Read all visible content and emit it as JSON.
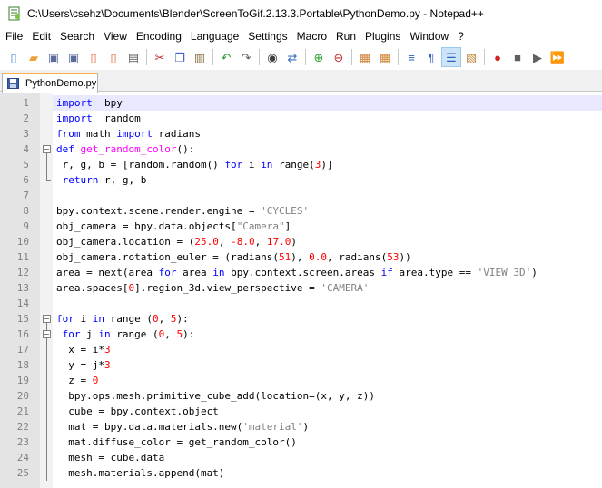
{
  "window": {
    "title": "C:\\Users\\csehz\\Documents\\Blender\\ScreenToGif.2.13.3.Portable\\PythonDemo.py - Notepad++"
  },
  "menu": {
    "items": [
      "File",
      "Edit",
      "Search",
      "View",
      "Encoding",
      "Language",
      "Settings",
      "Macro",
      "Run",
      "Plugins",
      "Window",
      "?"
    ]
  },
  "toolbar": {
    "buttons": [
      {
        "icon": "new-file-icon",
        "glyph": "▯",
        "color": "#3a7bd5"
      },
      {
        "icon": "open-file-icon",
        "glyph": "▰",
        "color": "#e8a33d"
      },
      {
        "icon": "save-icon",
        "glyph": "▣",
        "color": "#5a6c9a"
      },
      {
        "icon": "save-all-icon",
        "glyph": "▣",
        "color": "#5a6c9a"
      },
      {
        "icon": "close-icon",
        "glyph": "▯",
        "color": "#e06030"
      },
      {
        "icon": "close-all-icon",
        "glyph": "▯",
        "color": "#e06030"
      },
      {
        "icon": "print-icon",
        "glyph": "▤",
        "color": "#606060"
      },
      {
        "sep": true
      },
      {
        "icon": "cut-icon",
        "glyph": "✂",
        "color": "#c03030"
      },
      {
        "icon": "copy-icon",
        "glyph": "❐",
        "color": "#4060c0"
      },
      {
        "icon": "paste-icon",
        "glyph": "▥",
        "color": "#806030"
      },
      {
        "sep": true
      },
      {
        "icon": "undo-icon",
        "glyph": "↶",
        "color": "#2a9a2a"
      },
      {
        "icon": "redo-icon",
        "glyph": "↷",
        "color": "#606060"
      },
      {
        "sep": true
      },
      {
        "icon": "find-icon",
        "glyph": "◉",
        "color": "#404040"
      },
      {
        "icon": "replace-icon",
        "glyph": "⇄",
        "color": "#4070c0"
      },
      {
        "sep": true
      },
      {
        "icon": "zoom-in-icon",
        "glyph": "⊕",
        "color": "#30a030"
      },
      {
        "icon": "zoom-out-icon",
        "glyph": "⊖",
        "color": "#c03030"
      },
      {
        "sep": true
      },
      {
        "icon": "sync-vertical-icon",
        "glyph": "▦",
        "color": "#d08030"
      },
      {
        "icon": "sync-horizontal-icon",
        "glyph": "▦",
        "color": "#d08030"
      },
      {
        "sep": true
      },
      {
        "icon": "word-wrap-icon",
        "glyph": "≡",
        "color": "#3060c0"
      },
      {
        "icon": "show-all-chars-icon",
        "glyph": "¶",
        "color": "#3060c0"
      },
      {
        "icon": "indent-guide-icon",
        "glyph": "☰",
        "color": "#3060c0",
        "active": true
      },
      {
        "icon": "user-lang-icon",
        "glyph": "▧",
        "color": "#c08030"
      },
      {
        "sep": true
      },
      {
        "icon": "record-macro-icon",
        "glyph": "●",
        "color": "#d02020"
      },
      {
        "icon": "stop-macro-icon",
        "glyph": "■",
        "color": "#606060"
      },
      {
        "icon": "play-macro-icon",
        "glyph": "▶",
        "color": "#606060"
      },
      {
        "icon": "run-macro-multiple-icon",
        "glyph": "⏩",
        "color": "#3060c0"
      }
    ]
  },
  "tabs": [
    {
      "label": "PythonDemo.py",
      "active": true
    }
  ],
  "editor": {
    "current_line": 1,
    "lines": [
      {
        "n": "1",
        "fold": "",
        "tokens": [
          [
            "kw",
            "import"
          ],
          [
            "",
            "  bpy"
          ]
        ]
      },
      {
        "n": "2",
        "fold": "",
        "tokens": [
          [
            "kw",
            "import"
          ],
          [
            "",
            "  random"
          ]
        ]
      },
      {
        "n": "3",
        "fold": "",
        "tokens": [
          [
            "kw",
            "from"
          ],
          [
            "",
            " math "
          ],
          [
            "kw",
            "import"
          ],
          [
            "",
            " radians"
          ]
        ]
      },
      {
        "n": "4",
        "fold": "open",
        "tokens": [
          [
            "def-kw",
            "def"
          ],
          [
            "",
            " "
          ],
          [
            "fn-name",
            "get_random_color"
          ],
          [
            "",
            "():"
          ]
        ]
      },
      {
        "n": "5",
        "fold": "line",
        "tokens": [
          [
            "",
            " r, g, b = [random.random() "
          ],
          [
            "kw",
            "for"
          ],
          [
            "",
            " i "
          ],
          [
            "kw",
            "in"
          ],
          [
            "",
            " range("
          ],
          [
            "num",
            "3"
          ],
          [
            "",
            ")]"
          ]
        ]
      },
      {
        "n": "6",
        "fold": "end",
        "tokens": [
          [
            "",
            " "
          ],
          [
            "kw",
            "return"
          ],
          [
            "",
            " r, g, b"
          ]
        ]
      },
      {
        "n": "7",
        "fold": "",
        "tokens": []
      },
      {
        "n": "8",
        "fold": "",
        "tokens": [
          [
            "",
            "bpy.context.scene.render.engine = "
          ],
          [
            "str",
            "'CYCLES'"
          ]
        ]
      },
      {
        "n": "9",
        "fold": "",
        "tokens": [
          [
            "",
            "obj_camera = bpy.data.objects["
          ],
          [
            "str",
            "\"Camera\""
          ],
          [
            "",
            "]"
          ]
        ]
      },
      {
        "n": "10",
        "fold": "",
        "tokens": [
          [
            "",
            "obj_camera.location = ("
          ],
          [
            "num",
            "25.0"
          ],
          [
            "",
            ", "
          ],
          [
            "num",
            "-8.0"
          ],
          [
            "",
            ", "
          ],
          [
            "num",
            "17.0"
          ],
          [
            "",
            ")"
          ]
        ]
      },
      {
        "n": "11",
        "fold": "",
        "tokens": [
          [
            "",
            "obj_camera.rotation_euler = (radians("
          ],
          [
            "num",
            "51"
          ],
          [
            "",
            "), "
          ],
          [
            "num",
            "0.0"
          ],
          [
            "",
            ", radians("
          ],
          [
            "num",
            "53"
          ],
          [
            "",
            "))"
          ]
        ]
      },
      {
        "n": "12",
        "fold": "",
        "tokens": [
          [
            "",
            "area = next(area "
          ],
          [
            "kw",
            "for"
          ],
          [
            "",
            " area "
          ],
          [
            "kw",
            "in"
          ],
          [
            "",
            " bpy.context.screen.areas "
          ],
          [
            "kw",
            "if"
          ],
          [
            "",
            " area.type == "
          ],
          [
            "str",
            "'VIEW_3D'"
          ],
          [
            "",
            ")"
          ]
        ]
      },
      {
        "n": "13",
        "fold": "",
        "tokens": [
          [
            "",
            "area.spaces["
          ],
          [
            "num",
            "0"
          ],
          [
            "",
            "].region_3d.view_perspective = "
          ],
          [
            "str",
            "'CAMERA'"
          ]
        ]
      },
      {
        "n": "14",
        "fold": "",
        "tokens": []
      },
      {
        "n": "15",
        "fold": "open",
        "tokens": [
          [
            "kw",
            "for"
          ],
          [
            "",
            " i "
          ],
          [
            "kw",
            "in"
          ],
          [
            "",
            " range ("
          ],
          [
            "num",
            "0"
          ],
          [
            "",
            ", "
          ],
          [
            "num",
            "5"
          ],
          [
            "",
            "):"
          ]
        ]
      },
      {
        "n": "16",
        "fold": "open-inner",
        "tokens": [
          [
            "",
            " "
          ],
          [
            "kw",
            "for"
          ],
          [
            "",
            " j "
          ],
          [
            "kw",
            "in"
          ],
          [
            "",
            " range ("
          ],
          [
            "num",
            "0"
          ],
          [
            "",
            ", "
          ],
          [
            "num",
            "5"
          ],
          [
            "",
            "):"
          ]
        ]
      },
      {
        "n": "17",
        "fold": "line",
        "tokens": [
          [
            "",
            "  x = i*"
          ],
          [
            "num",
            "3"
          ]
        ]
      },
      {
        "n": "18",
        "fold": "line",
        "tokens": [
          [
            "",
            "  y = j*"
          ],
          [
            "num",
            "3"
          ]
        ]
      },
      {
        "n": "19",
        "fold": "line",
        "tokens": [
          [
            "",
            "  z = "
          ],
          [
            "num",
            "0"
          ]
        ]
      },
      {
        "n": "20",
        "fold": "line",
        "tokens": [
          [
            "",
            "  bpy.ops.mesh.primitive_cube_add(location=(x, y, z))"
          ]
        ]
      },
      {
        "n": "21",
        "fold": "line",
        "tokens": [
          [
            "",
            "  cube = bpy.context.object"
          ]
        ]
      },
      {
        "n": "22",
        "fold": "line",
        "tokens": [
          [
            "",
            "  mat = bpy.data.materials.new("
          ],
          [
            "str",
            "'material'"
          ],
          [
            "",
            ")"
          ]
        ]
      },
      {
        "n": "23",
        "fold": "line",
        "tokens": [
          [
            "",
            "  mat.diffuse_color = get_random_color()"
          ]
        ]
      },
      {
        "n": "24",
        "fold": "line",
        "tokens": [
          [
            "",
            "  mesh = cube.data"
          ]
        ]
      },
      {
        "n": "25",
        "fold": "line",
        "tokens": [
          [
            "",
            "  mesh.materials.append(mat)"
          ]
        ]
      }
    ]
  }
}
